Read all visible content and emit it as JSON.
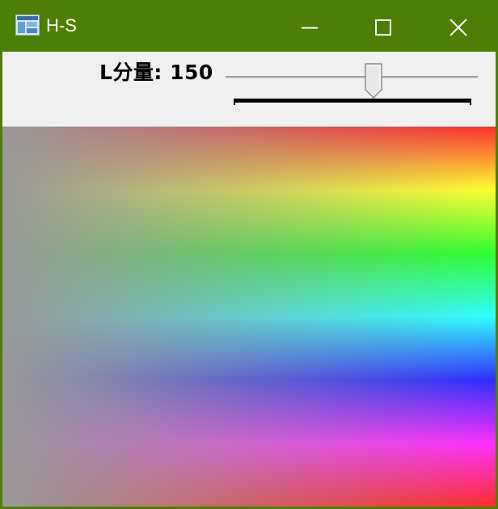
{
  "window": {
    "title": "H-S",
    "app_icon": "opencv-window-icon",
    "controls": {
      "minimize_icon": "minimize-icon",
      "maximize_icon": "maximize-icon",
      "close_icon": "close-icon"
    },
    "colors": {
      "titlebar": "#4e7e06",
      "title_text": "#ffffff"
    }
  },
  "trackbar": {
    "label": "L分量: 150",
    "name": "L分量",
    "value": 150,
    "value_fraction": 0.59
  },
  "image": {
    "description_name": "hue-saturation-map",
    "lightness": 150
  }
}
